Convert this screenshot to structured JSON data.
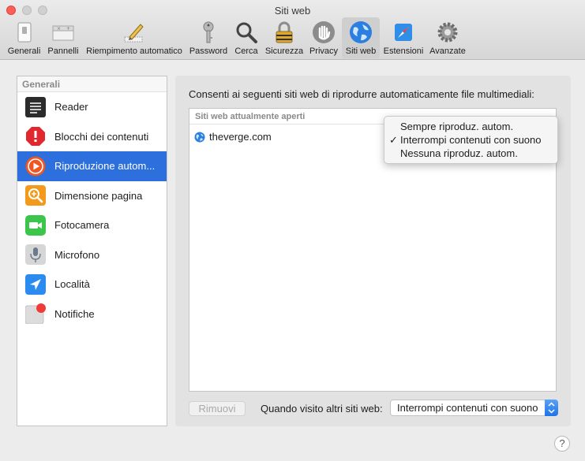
{
  "window": {
    "title": "Siti web"
  },
  "toolbar": {
    "items": [
      {
        "label": "Generali",
        "icon": "switch-icon"
      },
      {
        "label": "Pannelli",
        "icon": "tabs-icon"
      },
      {
        "label": "Riempimento automatico",
        "icon": "pencil-icon"
      },
      {
        "label": "Password",
        "icon": "key-icon"
      },
      {
        "label": "Cerca",
        "icon": "magnifier-icon"
      },
      {
        "label": "Sicurezza",
        "icon": "padlock-icon"
      },
      {
        "label": "Privacy",
        "icon": "hand-icon"
      },
      {
        "label": "Siti web",
        "icon": "globe-icon"
      },
      {
        "label": "Estensioni",
        "icon": "compass-icon"
      },
      {
        "label": "Avanzate",
        "icon": "gear-icon"
      }
    ],
    "active_index": 7
  },
  "sidebar": {
    "header": "Generali",
    "items": [
      {
        "label": "Reader"
      },
      {
        "label": "Blocchi dei contenuti"
      },
      {
        "label": "Riproduzione autom..."
      },
      {
        "label": "Dimensione pagina"
      },
      {
        "label": "Fotocamera"
      },
      {
        "label": "Microfono"
      },
      {
        "label": "Località"
      },
      {
        "label": "Notifiche"
      }
    ],
    "selected_index": 2
  },
  "main": {
    "description": "Consenti ai seguenti siti web di riprodurre automaticamente file multimediali:",
    "list_header": "Siti web attualmente aperti",
    "sites": [
      {
        "name": "theverge.com"
      }
    ],
    "remove_button": "Rimuovi",
    "other_sites_label": "Quando visito altri siti web:",
    "other_sites_value": "Interrompi contenuti con suono"
  },
  "popup": {
    "options": [
      {
        "label": "Sempre riproduz. autom.",
        "checked": false
      },
      {
        "label": "Interrompi contenuti con suono",
        "checked": true
      },
      {
        "label": "Nessuna riproduz. autom.",
        "checked": false
      }
    ]
  },
  "help": {
    "label": "?"
  },
  "colors": {
    "selection": "#2d6fdc",
    "close_button": "#fc5f57",
    "accent": "#1f73e6"
  }
}
